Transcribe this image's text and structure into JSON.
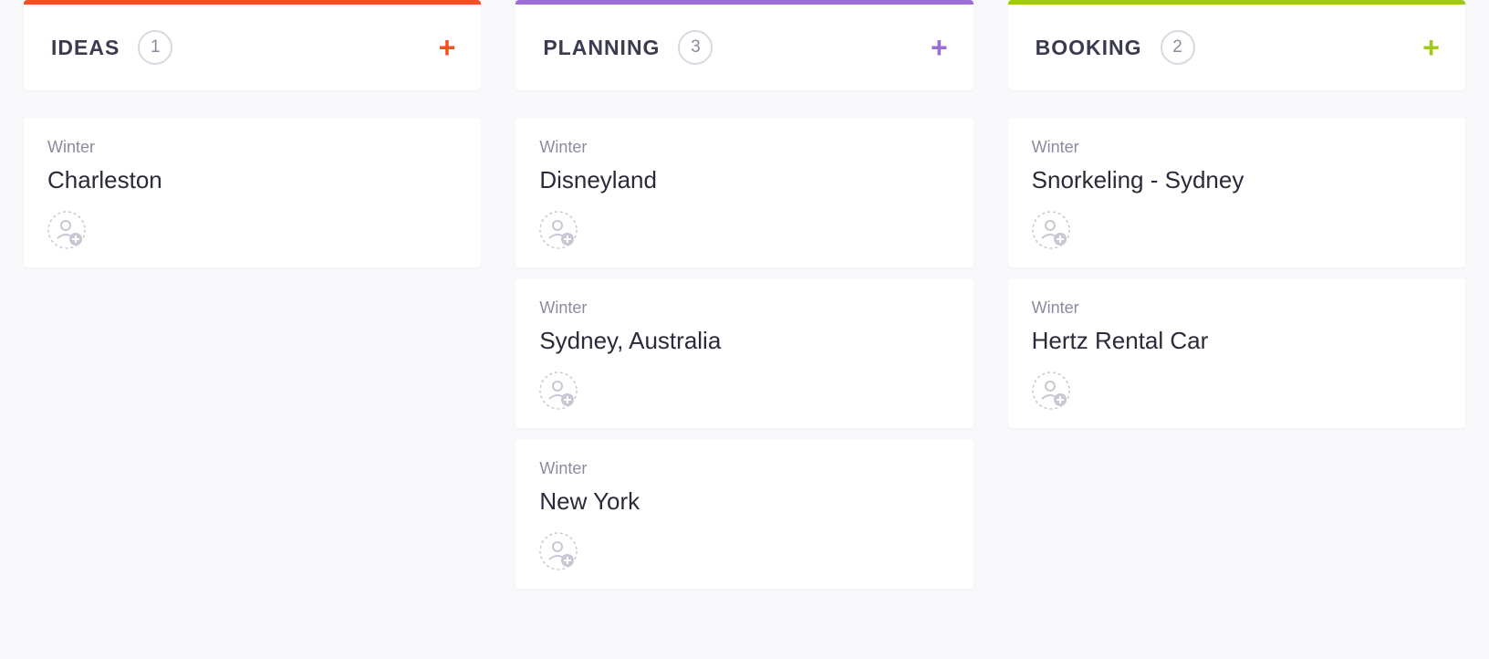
{
  "columns": [
    {
      "title": "IDEAS",
      "count": "1",
      "accent": "orange",
      "cards": [
        {
          "tag": "Winter",
          "title": "Charleston"
        }
      ]
    },
    {
      "title": "PLANNING",
      "count": "3",
      "accent": "purple",
      "cards": [
        {
          "tag": "Winter",
          "title": "Disneyland"
        },
        {
          "tag": "Winter",
          "title": "Sydney, Australia"
        },
        {
          "tag": "Winter",
          "title": "New York"
        }
      ]
    },
    {
      "title": "BOOKING",
      "count": "2",
      "accent": "green",
      "cards": [
        {
          "tag": "Winter",
          "title": "Snorkeling - Sydney"
        },
        {
          "tag": "Winter",
          "title": "Hertz Rental Car"
        }
      ]
    }
  ]
}
